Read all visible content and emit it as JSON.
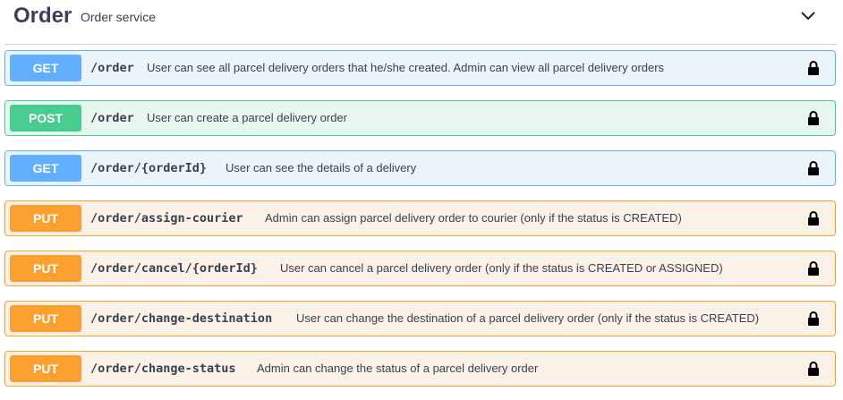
{
  "tag": {
    "title": "Order",
    "description": "Order service",
    "toggle_icon": "chevron-down-icon"
  },
  "operations": [
    {
      "method": "GET",
      "path": "/order",
      "summary": "User can see all parcel delivery orders that he/she created. Admin can view all parcel delivery orders",
      "color": "#61affe"
    },
    {
      "method": "POST",
      "path": "/order",
      "summary": "User can create a parcel delivery order",
      "color": "#49cc90"
    },
    {
      "method": "GET",
      "path": "/order/{orderId}",
      "summary": "User can see the details of a delivery",
      "color": "#61affe"
    },
    {
      "method": "PUT",
      "path": "/order/assign-courier",
      "summary": "Admin can assign parcel delivery order to courier (only if the status is CREATED)",
      "color": "#fca130"
    },
    {
      "method": "PUT",
      "path": "/order/cancel/{orderId}",
      "summary": "User can cancel a parcel delivery order (only if the status is CREATED or ASSIGNED)",
      "color": "#fca130"
    },
    {
      "method": "PUT",
      "path": "/order/change-destination",
      "summary": "User can change the destination of a parcel delivery order (only if the status is CREATED)",
      "color": "#fca130"
    },
    {
      "method": "PUT",
      "path": "/order/change-status",
      "summary": "Admin can change the status of a parcel delivery order",
      "color": "#fca130"
    }
  ]
}
